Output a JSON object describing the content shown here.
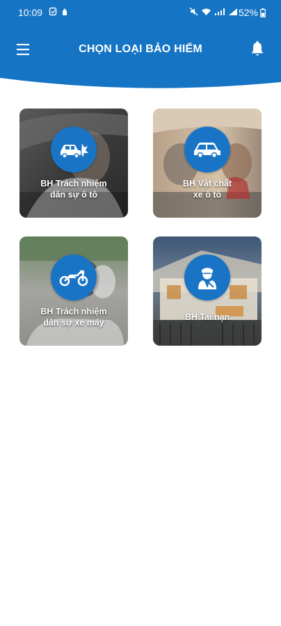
{
  "status_bar": {
    "time": "10:09",
    "battery": "52%"
  },
  "header": {
    "title": "CHỌN LOẠI BẢO HIỂM",
    "background_color": "#1574c4"
  },
  "cards": [
    {
      "line1": "BH Trách nhiệm",
      "line2": "dân sự ô tô",
      "icon": "car-crash-icon"
    },
    {
      "line1": "BH Vật chất",
      "line2": "xe ô tô",
      "icon": "car-icon"
    },
    {
      "line1": "BH Trách nhiệm",
      "line2": "dân sự xe máy",
      "icon": "motorcycle-icon"
    },
    {
      "line1": "BH Tai nạn",
      "line2": "",
      "icon": "person-injury-icon"
    }
  ]
}
